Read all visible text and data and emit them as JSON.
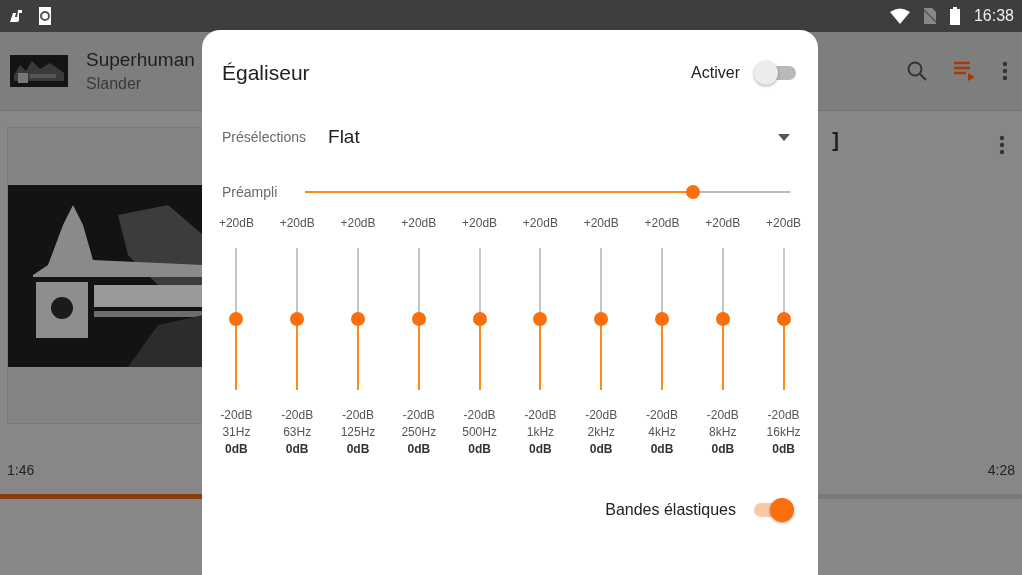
{
  "status_bar": {
    "time": "16:38"
  },
  "toolbar": {
    "title": "Superhuman",
    "subtitle": "Slander"
  },
  "player": {
    "side_text": "]",
    "elapsed": "1:46",
    "duration": "4:28",
    "level": 0.2
  },
  "equalizer": {
    "title": "Égaliseur",
    "enable": {
      "label": "Activer",
      "on": false
    },
    "presets": {
      "label": "Présélections",
      "value": "Flat"
    },
    "preamp": {
      "label": "Préampli",
      "level": 0.8
    },
    "bands": [
      {
        "top": "+20dB",
        "bottom": "-20dB",
        "freq": "31Hz",
        "value": "0dB",
        "level": 0.5
      },
      {
        "top": "+20dB",
        "bottom": "-20dB",
        "freq": "63Hz",
        "value": "0dB",
        "level": 0.5
      },
      {
        "top": "+20dB",
        "bottom": "-20dB",
        "freq": "125Hz",
        "value": "0dB",
        "level": 0.5
      },
      {
        "top": "+20dB",
        "bottom": "-20dB",
        "freq": "250Hz",
        "value": "0dB",
        "level": 0.5
      },
      {
        "top": "+20dB",
        "bottom": "-20dB",
        "freq": "500Hz",
        "value": "0dB",
        "level": 0.5
      },
      {
        "top": "+20dB",
        "bottom": "-20dB",
        "freq": "1kHz",
        "value": "0dB",
        "level": 0.5
      },
      {
        "top": "+20dB",
        "bottom": "-20dB",
        "freq": "2kHz",
        "value": "0dB",
        "level": 0.5
      },
      {
        "top": "+20dB",
        "bottom": "-20dB",
        "freq": "4kHz",
        "value": "0dB",
        "level": 0.5
      },
      {
        "top": "+20dB",
        "bottom": "-20dB",
        "freq": "8kHz",
        "value": "0dB",
        "level": 0.5
      },
      {
        "top": "+20dB",
        "bottom": "-20dB",
        "freq": "16kHz",
        "value": "0dB",
        "level": 0.5
      }
    ],
    "elastic": {
      "label": "Bandes élastiques",
      "on": true
    }
  }
}
